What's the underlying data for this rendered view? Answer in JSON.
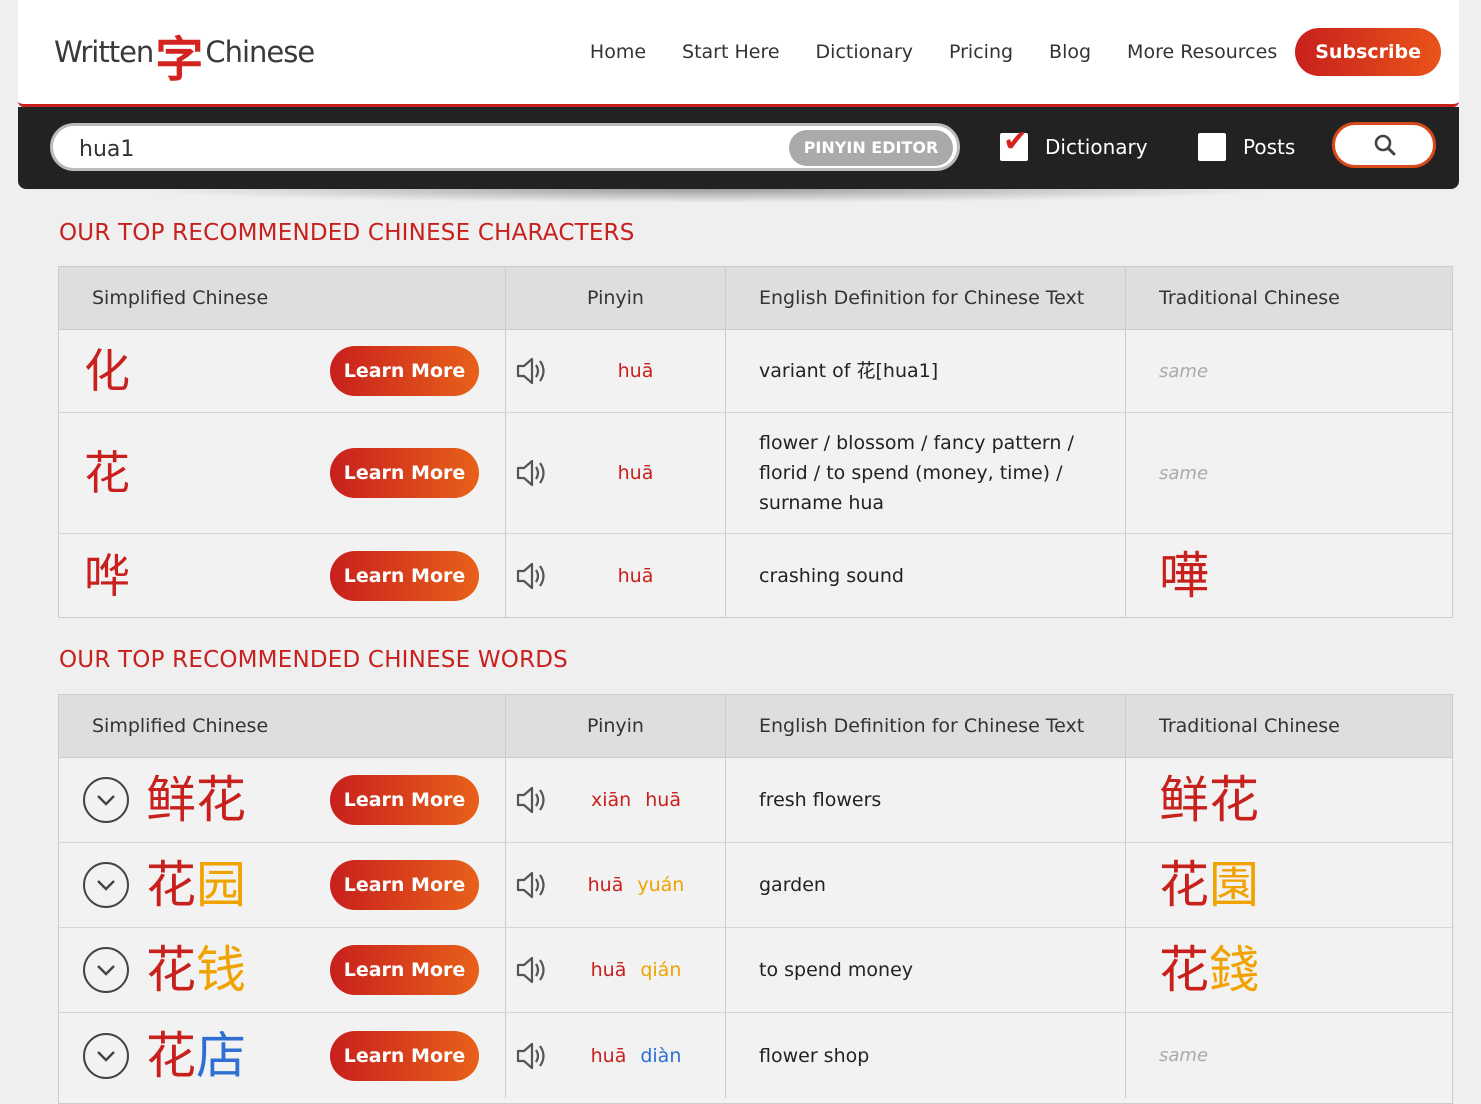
{
  "header": {
    "logo": {
      "left": "Written",
      "char": "字",
      "right": "Chinese"
    },
    "nav": [
      "Home",
      "Start Here",
      "Dictionary",
      "Pricing",
      "Blog",
      "More Resources"
    ],
    "subscribe": "Subscribe"
  },
  "search": {
    "value": "hua1",
    "pinyin_editor": "PINYIN EDITOR",
    "dictionary_label": "Dictionary",
    "dictionary_checked": true,
    "posts_label": "Posts",
    "posts_checked": false
  },
  "characters": {
    "title": "OUR TOP RECOMMENDED CHINESE CHARACTERS",
    "headers": [
      "Simplified Chinese",
      "Pinyin",
      "English Definition for Chinese Text",
      "Traditional Chinese"
    ],
    "rows": [
      {
        "simplified": "化",
        "pinyin": "huā",
        "definition": "variant of 花[hua1]",
        "traditional": "same"
      },
      {
        "simplified": "花",
        "pinyin": "huā",
        "definition_lines": [
          "flower / blossom / fancy pattern /",
          "florid / to spend (money, time) /",
          "surname hua"
        ],
        "traditional": "same"
      },
      {
        "simplified": "哗",
        "pinyin": "huā",
        "definition": "crashing sound",
        "traditional": "嘩"
      }
    ],
    "learn_more": "Learn More"
  },
  "words": {
    "title": "OUR TOP RECOMMENDED CHINESE WORDS",
    "headers": [
      "Simplified Chinese",
      "Pinyin",
      "English Definition for Chinese Text",
      "Traditional Chinese"
    ],
    "learn_more": "Learn More",
    "rows": [
      {
        "s1": "鲜",
        "s2": "花",
        "p1": "xiān",
        "p2": "huā",
        "definition": "fresh flowers",
        "t1": "鲜",
        "t2": "花"
      },
      {
        "s1": "花",
        "s2": "园",
        "p1": "huā",
        "p2": "yuán",
        "definition": "garden",
        "t1": "花",
        "t2": "園"
      },
      {
        "s1": "花",
        "s2": "钱",
        "p1": "huā",
        "p2": "qián",
        "definition": "to spend money",
        "t1": "花",
        "t2": "錢"
      },
      {
        "s1": "花",
        "s2": "店",
        "p1": "huā",
        "p2": "diàn",
        "definition": "flower shop",
        "traditional": "same"
      }
    ]
  },
  "colors": {
    "accent": "#c8201d",
    "tone1": "#c8201d",
    "tone2": "#f0a300",
    "tone4": "#2f6fd3"
  },
  "icons": {
    "speaker": "speaker-icon",
    "search": "search-icon",
    "expand": "chevron-down-icon"
  }
}
